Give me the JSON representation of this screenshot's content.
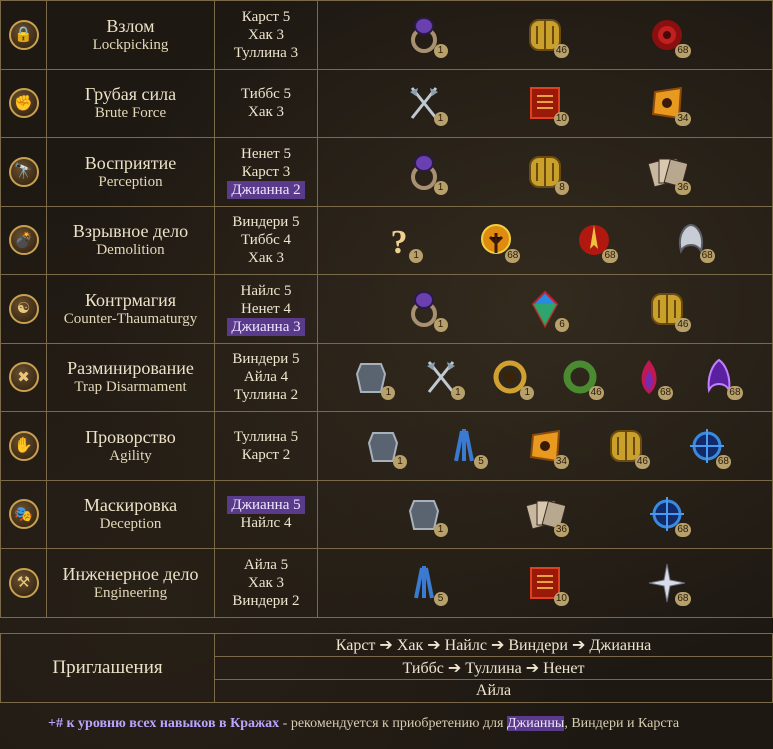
{
  "rows": [
    {
      "ru": "Взлом",
      "en": "Lockpicking",
      "icon": "lock-icon",
      "icon_glyph": "🔒",
      "crew": [
        {
          "t": "Карст 5",
          "hl": false
        },
        {
          "t": "Хак 3",
          "hl": false
        },
        {
          "t": "Туллина 3",
          "hl": false
        }
      ],
      "items": [
        {
          "icon": "ring-purple-icon",
          "lvl": "1"
        },
        {
          "icon": "golden-brain-icon",
          "lvl": "46"
        },
        {
          "icon": "red-rose-icon",
          "lvl": "68"
        }
      ]
    },
    {
      "ru": "Грубая сила",
      "en": "Brute Force",
      "icon": "knuckles-icon",
      "icon_glyph": "✊",
      "crew": [
        {
          "t": "Тиббс 5",
          "hl": false
        },
        {
          "t": "Хак 3",
          "hl": false
        }
      ],
      "items": [
        {
          "icon": "crossed-axes-icon",
          "lvl": "1"
        },
        {
          "icon": "red-tapestry-icon",
          "lvl": "10"
        },
        {
          "icon": "amber-spider-icon",
          "lvl": "34"
        }
      ]
    },
    {
      "ru": "Восприятие",
      "en": "Perception",
      "icon": "spyglass-icon",
      "icon_glyph": "🔭",
      "crew": [
        {
          "t": "Ненет 5",
          "hl": false
        },
        {
          "t": "Карст 3",
          "hl": false
        },
        {
          "t": "Джианна 2",
          "hl": true
        }
      ],
      "items": [
        {
          "icon": "ring-purple-icon",
          "lvl": "1"
        },
        {
          "icon": "golden-brain-icon",
          "lvl": "8"
        },
        {
          "icon": "card-deck-icon",
          "lvl": "36"
        }
      ]
    },
    {
      "ru": "Взрывное дело",
      "en": "Demolition",
      "icon": "bomb-icon",
      "icon_glyph": "💣",
      "crew": [
        {
          "t": "Виндери 5",
          "hl": false
        },
        {
          "t": "Тиббс 4",
          "hl": false
        },
        {
          "t": "Хак 3",
          "hl": false
        }
      ],
      "items": [
        {
          "icon": "question-mark-icon",
          "lvl": "1"
        },
        {
          "icon": "fire-tree-icon",
          "lvl": "68"
        },
        {
          "icon": "flame-spike-icon",
          "lvl": "68"
        },
        {
          "icon": "silver-claw-icon",
          "lvl": "68"
        }
      ]
    },
    {
      "ru": "Контрмагия",
      "en": "Counter-Thaumaturgy",
      "icon": "rune-ring-icon",
      "icon_glyph": "☯",
      "crew": [
        {
          "t": "Найлс 5",
          "hl": false
        },
        {
          "t": "Ненет 4",
          "hl": false
        },
        {
          "t": "Джианна 3",
          "hl": true
        }
      ],
      "items": [
        {
          "icon": "ring-purple-icon",
          "lvl": "1"
        },
        {
          "icon": "prism-gem-icon",
          "lvl": "6"
        },
        {
          "icon": "golden-brain-icon",
          "lvl": "46"
        }
      ]
    },
    {
      "ru": "Разминирование",
      "en": "Trap Disarmament",
      "icon": "trap-icon",
      "icon_glyph": "✖",
      "crew": [
        {
          "t": "Виндери 5",
          "hl": false
        },
        {
          "t": "Айла 4",
          "hl": false
        },
        {
          "t": "Туллина 2",
          "hl": false
        }
      ],
      "items": [
        {
          "icon": "chainmail-icon",
          "lvl": "1"
        },
        {
          "icon": "crossed-axes-icon",
          "lvl": "1"
        },
        {
          "icon": "gold-sun-ring-icon",
          "lvl": "1"
        },
        {
          "icon": "green-wreath-icon",
          "lvl": "46"
        },
        {
          "icon": "red-violet-flame-icon",
          "lvl": "68"
        },
        {
          "icon": "purple-claw-icon",
          "lvl": "68"
        }
      ]
    },
    {
      "ru": "Проворство",
      "en": "Agility",
      "icon": "hand-icon",
      "icon_glyph": "✋",
      "crew": [
        {
          "t": "Туллина 5",
          "hl": false
        },
        {
          "t": "Карст 2",
          "hl": false
        }
      ],
      "items": [
        {
          "icon": "chainmail-icon",
          "lvl": "1"
        },
        {
          "icon": "blue-claws-icon",
          "lvl": "5"
        },
        {
          "icon": "amber-spider-icon",
          "lvl": "34"
        },
        {
          "icon": "golden-brain-icon",
          "lvl": "46"
        },
        {
          "icon": "blue-star-orb-icon",
          "lvl": "68"
        }
      ]
    },
    {
      "ru": "Маскировка",
      "en": "Deception",
      "icon": "mask-icon",
      "icon_glyph": "🎭",
      "crew": [
        {
          "t": "Джианна 5",
          "hl": true
        },
        {
          "t": "Найлс 4",
          "hl": false
        }
      ],
      "items": [
        {
          "icon": "chainmail-icon",
          "lvl": "1"
        },
        {
          "icon": "card-deck-icon",
          "lvl": "36"
        },
        {
          "icon": "blue-star-orb-icon",
          "lvl": "68"
        }
      ]
    },
    {
      "ru": "Инженерное дело",
      "en": "Engineering",
      "icon": "crossed-tools-icon",
      "icon_glyph": "⚒",
      "crew": [
        {
          "t": "Айла 5",
          "hl": false
        },
        {
          "t": "Хак 3",
          "hl": false
        },
        {
          "t": "Виндери 2",
          "hl": false
        }
      ],
      "items": [
        {
          "icon": "blue-claws-icon",
          "lvl": "5"
        },
        {
          "icon": "red-tapestry-icon",
          "lvl": "10"
        },
        {
          "icon": "compass-star-icon",
          "lvl": "68"
        }
      ]
    }
  ],
  "invitations": {
    "label": "Приглашения",
    "lines": [
      "Карст ➔ Хак ➔ Найлс ➔ Виндери ➔ Джианна",
      "Тиббс ➔ Туллина ➔ Ненет",
      "Айла"
    ]
  },
  "footnote": {
    "accent": "+# к уровню всех навыков в Кражах",
    "mid": " - рекомендуется к приобретению для ",
    "hl": "Джианны",
    "tail": ", Виндери и Карста"
  },
  "colors": {
    "border": "#7a6a4a",
    "highlight": "#5a3a8a",
    "accent": "#b9a6ff",
    "badge": "#b7a06a"
  }
}
